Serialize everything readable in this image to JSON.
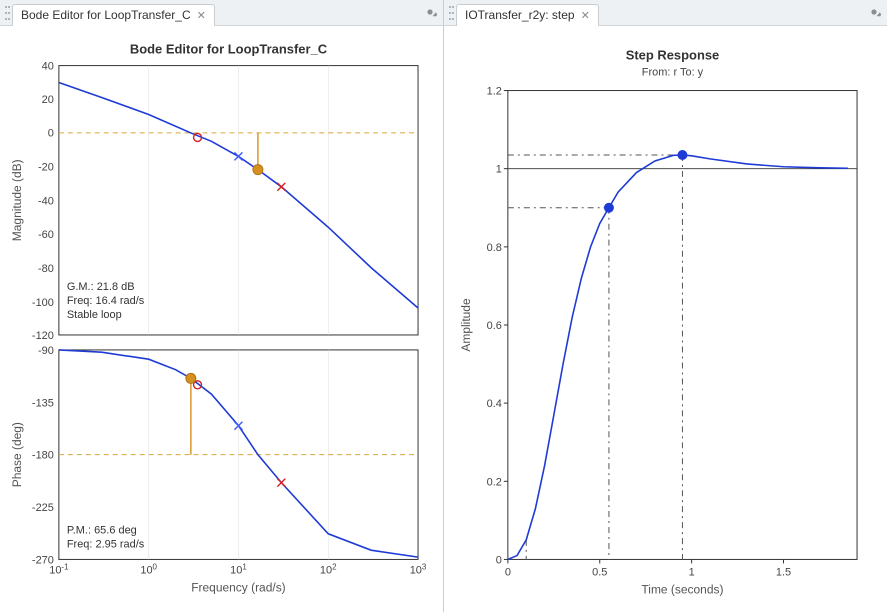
{
  "left": {
    "tab_label": "Bode Editor for LoopTransfer_C",
    "title": "Bode Editor for LoopTransfer_C",
    "xlabel": "Frequency (rad/s)",
    "mag": {
      "ylabel": "Magnitude (dB)",
      "annot1": "G.M.: 21.8 dB",
      "annot2": "Freq: 16.4 rad/s",
      "annot3": "Stable loop"
    },
    "phase": {
      "ylabel": "Phase (deg)",
      "annot1": "P.M.: 65.6 deg",
      "annot2": "Freq: 2.95 rad/s"
    }
  },
  "right": {
    "tab_label": "IOTransfer_r2y: step",
    "title": "Step Response",
    "subtitle": "From: r  To: y",
    "xlabel": "Time (seconds)",
    "ylabel": "Amplitude"
  },
  "chart_data": [
    {
      "type": "line",
      "name": "bode_magnitude",
      "title": "Bode Editor for LoopTransfer_C",
      "xlabel": "Frequency (rad/s)",
      "ylabel": "Magnitude (dB)",
      "xscale": "log",
      "xlim": [
        0.1,
        1000
      ],
      "ylim": [
        -120,
        40
      ],
      "yticks": [
        -120,
        -100,
        -80,
        -60,
        -40,
        -20,
        0,
        20,
        40
      ],
      "x": [
        0.1,
        0.3,
        1,
        2.95,
        5,
        10,
        16.4,
        30,
        100,
        300,
        1000
      ],
      "y": [
        30,
        21,
        11,
        0,
        -5,
        -14,
        -21.8,
        -32,
        -56,
        -80,
        -104
      ],
      "annotations": {
        "gain_margin_dB": 21.8,
        "gm_freq_rad_s": 16.4,
        "stability": "Stable loop"
      },
      "markers": {
        "pole_freqs_rad_s": [
          10,
          30
        ],
        "zero_freqs_rad_s": [
          3.5
        ],
        "margin_freq_rad_s": 16.4
      }
    },
    {
      "type": "line",
      "name": "bode_phase",
      "xlabel": "Frequency (rad/s)",
      "ylabel": "Phase (deg)",
      "xscale": "log",
      "xlim": [
        0.1,
        1000
      ],
      "ylim": [
        -270,
        -90
      ],
      "yticks": [
        -270,
        -225,
        -180,
        -135,
        -90
      ],
      "x": [
        0.1,
        0.3,
        1,
        2,
        2.95,
        5,
        10,
        16.4,
        30,
        100,
        300,
        1000
      ],
      "y": [
        -90,
        -92,
        -98,
        -107,
        -114.4,
        -128,
        -155,
        -180,
        -204,
        -248,
        -262,
        -268
      ],
      "annotations": {
        "phase_margin_deg": 65.6,
        "pm_freq_rad_s": 2.95
      }
    },
    {
      "type": "line",
      "name": "step_response",
      "title": "Step Response",
      "subtitle": "From: r  To: y",
      "xlabel": "Time (seconds)",
      "ylabel": "Amplitude",
      "xlim": [
        0,
        1.9
      ],
      "ylim": [
        0,
        1.2
      ],
      "xticks": [
        0,
        0.5,
        1,
        1.5
      ],
      "yticks": [
        0,
        0.2,
        0.4,
        0.6,
        0.8,
        1.0,
        1.2
      ],
      "x": [
        0,
        0.05,
        0.1,
        0.15,
        0.2,
        0.25,
        0.3,
        0.35,
        0.4,
        0.45,
        0.5,
        0.55,
        0.6,
        0.7,
        0.8,
        0.9,
        0.95,
        1.0,
        1.1,
        1.3,
        1.5,
        1.7,
        1.85
      ],
      "y": [
        0.0,
        0.01,
        0.05,
        0.13,
        0.24,
        0.37,
        0.5,
        0.62,
        0.72,
        0.8,
        0.86,
        0.9,
        0.94,
        0.99,
        1.02,
        1.034,
        1.035,
        1.033,
        1.025,
        1.012,
        1.005,
        1.002,
        1.001
      ],
      "reference_lines": {
        "rise_time_s": 0.55,
        "rise_level": 0.9,
        "peak_time_s": 0.95,
        "peak_level": 1.035,
        "final_value": 1.0,
        "delay_time_s": 0.1
      }
    }
  ]
}
